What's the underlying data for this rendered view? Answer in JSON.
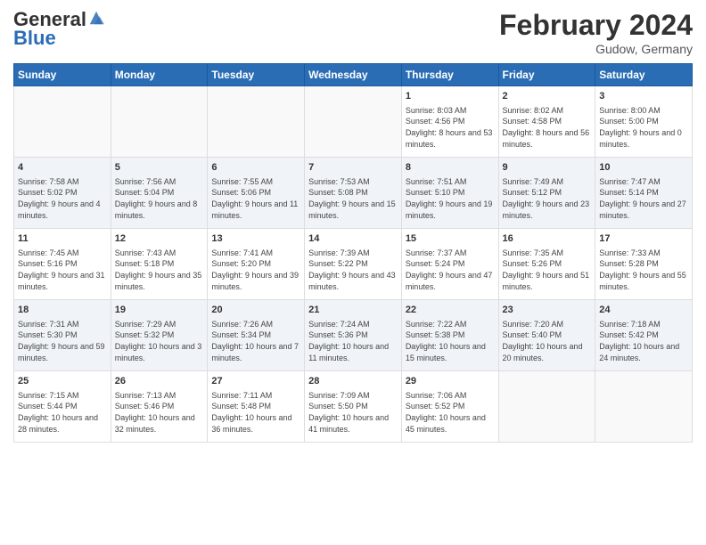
{
  "header": {
    "logo_line1": "General",
    "logo_line2": "Blue",
    "month_title": "February 2024",
    "location": "Gudow, Germany"
  },
  "days_of_week": [
    "Sunday",
    "Monday",
    "Tuesday",
    "Wednesday",
    "Thursday",
    "Friday",
    "Saturday"
  ],
  "weeks": [
    [
      {
        "day": "",
        "sunrise": "",
        "sunset": "",
        "daylight": ""
      },
      {
        "day": "",
        "sunrise": "",
        "sunset": "",
        "daylight": ""
      },
      {
        "day": "",
        "sunrise": "",
        "sunset": "",
        "daylight": ""
      },
      {
        "day": "",
        "sunrise": "",
        "sunset": "",
        "daylight": ""
      },
      {
        "day": "1",
        "sunrise": "Sunrise: 8:03 AM",
        "sunset": "Sunset: 4:56 PM",
        "daylight": "Daylight: 8 hours and 53 minutes."
      },
      {
        "day": "2",
        "sunrise": "Sunrise: 8:02 AM",
        "sunset": "Sunset: 4:58 PM",
        "daylight": "Daylight: 8 hours and 56 minutes."
      },
      {
        "day": "3",
        "sunrise": "Sunrise: 8:00 AM",
        "sunset": "Sunset: 5:00 PM",
        "daylight": "Daylight: 9 hours and 0 minutes."
      }
    ],
    [
      {
        "day": "4",
        "sunrise": "Sunrise: 7:58 AM",
        "sunset": "Sunset: 5:02 PM",
        "daylight": "Daylight: 9 hours and 4 minutes."
      },
      {
        "day": "5",
        "sunrise": "Sunrise: 7:56 AM",
        "sunset": "Sunset: 5:04 PM",
        "daylight": "Daylight: 9 hours and 8 minutes."
      },
      {
        "day": "6",
        "sunrise": "Sunrise: 7:55 AM",
        "sunset": "Sunset: 5:06 PM",
        "daylight": "Daylight: 9 hours and 11 minutes."
      },
      {
        "day": "7",
        "sunrise": "Sunrise: 7:53 AM",
        "sunset": "Sunset: 5:08 PM",
        "daylight": "Daylight: 9 hours and 15 minutes."
      },
      {
        "day": "8",
        "sunrise": "Sunrise: 7:51 AM",
        "sunset": "Sunset: 5:10 PM",
        "daylight": "Daylight: 9 hours and 19 minutes."
      },
      {
        "day": "9",
        "sunrise": "Sunrise: 7:49 AM",
        "sunset": "Sunset: 5:12 PM",
        "daylight": "Daylight: 9 hours and 23 minutes."
      },
      {
        "day": "10",
        "sunrise": "Sunrise: 7:47 AM",
        "sunset": "Sunset: 5:14 PM",
        "daylight": "Daylight: 9 hours and 27 minutes."
      }
    ],
    [
      {
        "day": "11",
        "sunrise": "Sunrise: 7:45 AM",
        "sunset": "Sunset: 5:16 PM",
        "daylight": "Daylight: 9 hours and 31 minutes."
      },
      {
        "day": "12",
        "sunrise": "Sunrise: 7:43 AM",
        "sunset": "Sunset: 5:18 PM",
        "daylight": "Daylight: 9 hours and 35 minutes."
      },
      {
        "day": "13",
        "sunrise": "Sunrise: 7:41 AM",
        "sunset": "Sunset: 5:20 PM",
        "daylight": "Daylight: 9 hours and 39 minutes."
      },
      {
        "day": "14",
        "sunrise": "Sunrise: 7:39 AM",
        "sunset": "Sunset: 5:22 PM",
        "daylight": "Daylight: 9 hours and 43 minutes."
      },
      {
        "day": "15",
        "sunrise": "Sunrise: 7:37 AM",
        "sunset": "Sunset: 5:24 PM",
        "daylight": "Daylight: 9 hours and 47 minutes."
      },
      {
        "day": "16",
        "sunrise": "Sunrise: 7:35 AM",
        "sunset": "Sunset: 5:26 PM",
        "daylight": "Daylight: 9 hours and 51 minutes."
      },
      {
        "day": "17",
        "sunrise": "Sunrise: 7:33 AM",
        "sunset": "Sunset: 5:28 PM",
        "daylight": "Daylight: 9 hours and 55 minutes."
      }
    ],
    [
      {
        "day": "18",
        "sunrise": "Sunrise: 7:31 AM",
        "sunset": "Sunset: 5:30 PM",
        "daylight": "Daylight: 9 hours and 59 minutes."
      },
      {
        "day": "19",
        "sunrise": "Sunrise: 7:29 AM",
        "sunset": "Sunset: 5:32 PM",
        "daylight": "Daylight: 10 hours and 3 minutes."
      },
      {
        "day": "20",
        "sunrise": "Sunrise: 7:26 AM",
        "sunset": "Sunset: 5:34 PM",
        "daylight": "Daylight: 10 hours and 7 minutes."
      },
      {
        "day": "21",
        "sunrise": "Sunrise: 7:24 AM",
        "sunset": "Sunset: 5:36 PM",
        "daylight": "Daylight: 10 hours and 11 minutes."
      },
      {
        "day": "22",
        "sunrise": "Sunrise: 7:22 AM",
        "sunset": "Sunset: 5:38 PM",
        "daylight": "Daylight: 10 hours and 15 minutes."
      },
      {
        "day": "23",
        "sunrise": "Sunrise: 7:20 AM",
        "sunset": "Sunset: 5:40 PM",
        "daylight": "Daylight: 10 hours and 20 minutes."
      },
      {
        "day": "24",
        "sunrise": "Sunrise: 7:18 AM",
        "sunset": "Sunset: 5:42 PM",
        "daylight": "Daylight: 10 hours and 24 minutes."
      }
    ],
    [
      {
        "day": "25",
        "sunrise": "Sunrise: 7:15 AM",
        "sunset": "Sunset: 5:44 PM",
        "daylight": "Daylight: 10 hours and 28 minutes."
      },
      {
        "day": "26",
        "sunrise": "Sunrise: 7:13 AM",
        "sunset": "Sunset: 5:46 PM",
        "daylight": "Daylight: 10 hours and 32 minutes."
      },
      {
        "day": "27",
        "sunrise": "Sunrise: 7:11 AM",
        "sunset": "Sunset: 5:48 PM",
        "daylight": "Daylight: 10 hours and 36 minutes."
      },
      {
        "day": "28",
        "sunrise": "Sunrise: 7:09 AM",
        "sunset": "Sunset: 5:50 PM",
        "daylight": "Daylight: 10 hours and 41 minutes."
      },
      {
        "day": "29",
        "sunrise": "Sunrise: 7:06 AM",
        "sunset": "Sunset: 5:52 PM",
        "daylight": "Daylight: 10 hours and 45 minutes."
      },
      {
        "day": "",
        "sunrise": "",
        "sunset": "",
        "daylight": ""
      },
      {
        "day": "",
        "sunrise": "",
        "sunset": "",
        "daylight": ""
      }
    ]
  ]
}
